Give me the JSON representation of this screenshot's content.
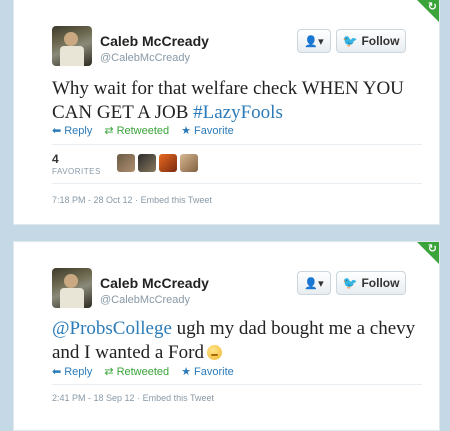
{
  "tweets": [
    {
      "name": "Caleb McCready",
      "handle": "@CalebMcCready",
      "follow_label": "Follow",
      "user_menu_icon": "user-dropdown-icon",
      "text_plain": "Why wait for that welfare check WHEN YOU CAN GET A JOB ",
      "text_tag": "#LazyFools",
      "actions": {
        "reply": "Reply",
        "retweeted": "Retweeted",
        "favorite": "Favorite"
      },
      "favorites_count": "4",
      "favorites_label": "FAVORITES",
      "timestamp": "7:18 PM - 28 Oct 12",
      "embed": "Embed this Tweet"
    },
    {
      "name": "Caleb McCready",
      "handle": "@CalebMcCready",
      "follow_label": "Follow",
      "user_menu_icon": "user-dropdown-icon",
      "text_mention": "@ProbsCollege",
      "text_plain": " ugh my dad bought me a chevy and I wanted a Ford",
      "actions": {
        "reply": "Reply",
        "retweeted": "Retweeted",
        "favorite": "Favorite"
      },
      "timestamp": "2:41 PM - 18 Sep 12",
      "embed": "Embed this Tweet"
    }
  ],
  "colors": {
    "link": "#2b7bb9",
    "retweet_green": "#3aa33a",
    "background": "#c4d8e6"
  }
}
